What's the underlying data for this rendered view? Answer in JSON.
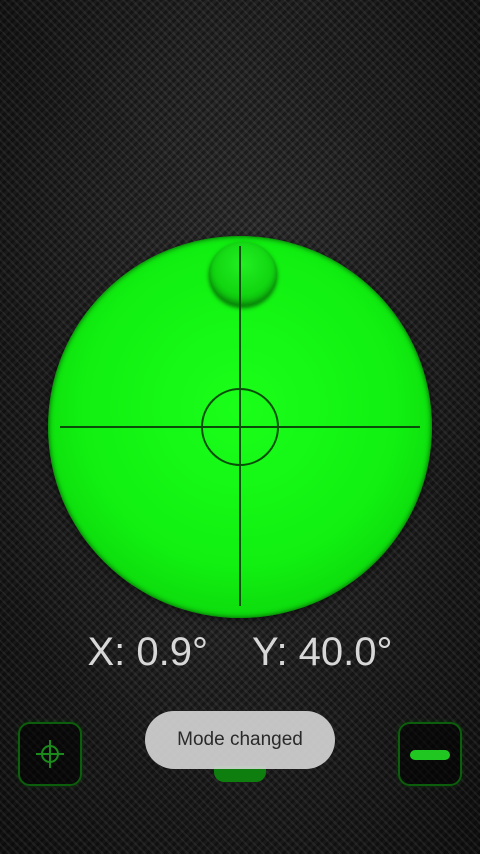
{
  "readout": {
    "x_label": "X: 0.9°",
    "y_label": "Y: 40.0°"
  },
  "toast": {
    "message": "Mode changed"
  },
  "icons": {
    "left_button": "crosshair-icon",
    "right_button": "minus-icon"
  },
  "colors": {
    "level_green": "#11f011",
    "crosshair": "#0a4d0a",
    "button_border": "#0c5d0c"
  },
  "tilt": {
    "x_degrees": 0.9,
    "y_degrees": 40.0
  }
}
